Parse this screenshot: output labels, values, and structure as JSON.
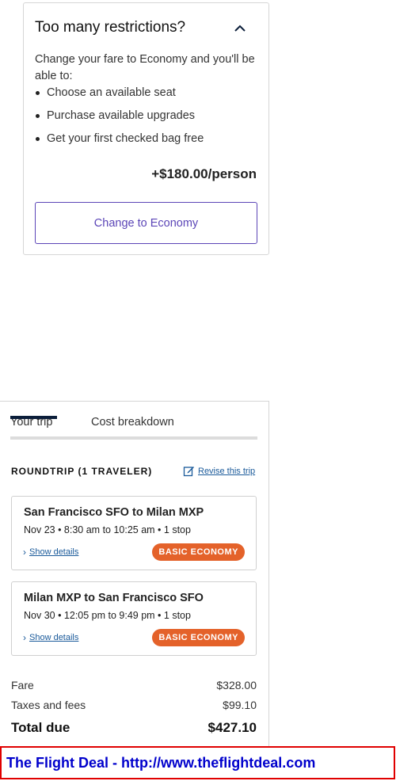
{
  "restrictions": {
    "title": "Too many restrictions?",
    "description": "Change your fare to Economy and you'll be able to:",
    "benefits": [
      "Choose an available seat",
      "Purchase available upgrades",
      "Get your first checked bag free"
    ],
    "price": "+$180.00/person",
    "button_label": "Change to Economy"
  },
  "trip": {
    "tabs": [
      "Your trip",
      "Cost breakdown"
    ],
    "roundtrip_label": "ROUNDTRIP (1 TRAVELER)",
    "revise_label": "Revise this trip",
    "segments": [
      {
        "route": "San Francisco SFO to Milan MXP",
        "times": "Nov 23 • 8:30 am to 10:25 am • 1 stop",
        "details_label": "Show details",
        "badge": "BASIC ECONOMY"
      },
      {
        "route": "Milan MXP to San Francisco SFO",
        "times": "Nov 30 • 12:05 pm to 9:49 pm • 1 stop",
        "details_label": "Show details",
        "badge": "BASIC ECONOMY"
      }
    ],
    "costs": {
      "fare_label": "Fare",
      "fare_value": "$328.00",
      "taxes_label": "Taxes and fees",
      "taxes_value": "$99.10",
      "total_label": "Total due",
      "total_value": "$427.10"
    }
  },
  "footer": {
    "text": "The Flight Deal - http://www.theflightdeal.com"
  },
  "colors": {
    "accent_purple": "#5b45b7",
    "badge_orange": "#e4622a",
    "link_blue": "#1a5a9a",
    "footer_border": "#e00000",
    "footer_text": "#0000cc"
  },
  "icons": {
    "collapse": "chevron-up-icon",
    "revise": "edit-icon",
    "details": "chevron-right-icon"
  }
}
